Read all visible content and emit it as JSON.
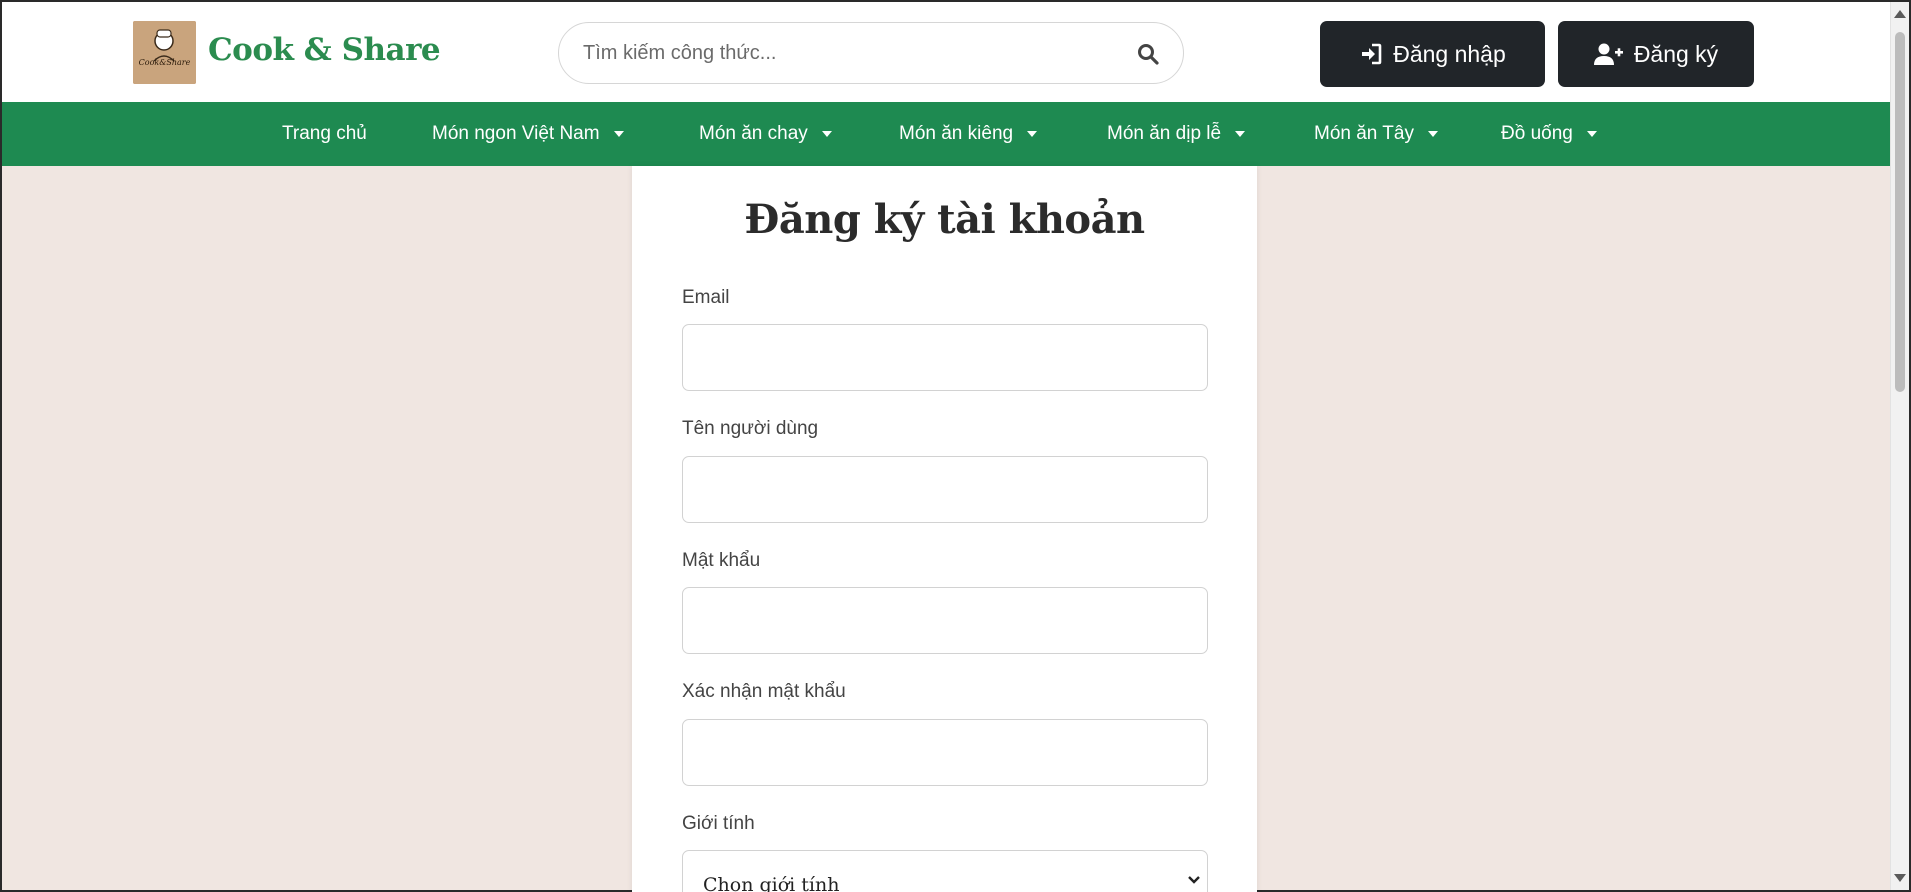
{
  "header": {
    "logo_alt_text": "Cook&Share",
    "brand": "Cook & Share",
    "search_placeholder": "Tìm kiếm công thức...",
    "login_label": "Đăng nhập",
    "register_label": "Đăng ký"
  },
  "nav": {
    "items": [
      {
        "label": "Trang chủ",
        "dropdown": false
      },
      {
        "label": "Món ngon Việt Nam",
        "dropdown": true
      },
      {
        "label": "Món ăn chay",
        "dropdown": true
      },
      {
        "label": "Món ăn kiêng",
        "dropdown": true
      },
      {
        "label": "Món ăn dịp lễ",
        "dropdown": true
      },
      {
        "label": "Món ăn Tây",
        "dropdown": true
      },
      {
        "label": "Đồ uống",
        "dropdown": true
      }
    ]
  },
  "form": {
    "title": "Đăng ký tài khoản",
    "email_label": "Email",
    "username_label": "Tên người dùng",
    "password_label": "Mật khẩu",
    "confirm_label": "Xác nhận mật khẩu",
    "gender_label": "Giới tính",
    "gender_selected": "Chọn giới tính"
  },
  "colors": {
    "brand_green": "#2b8c4f",
    "nav_green": "#1e8a51",
    "button_dark": "#212529",
    "page_bg": "#f0e6e1"
  }
}
